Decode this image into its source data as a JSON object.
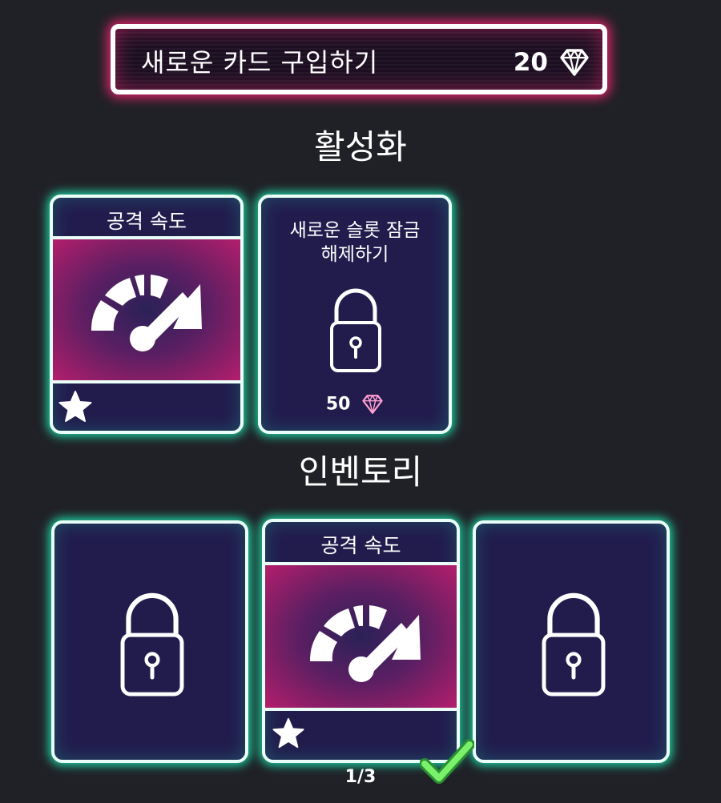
{
  "buy": {
    "label": "새로운 카드 구입하기",
    "price": "20",
    "icon": "gem-icon"
  },
  "active": {
    "title": "활성화",
    "card1": {
      "title": "공격 속도",
      "icon": "speedometer-icon",
      "badge": "star-icon"
    },
    "card2": {
      "line1": "새로운 슬롯 잠금",
      "line2": "해제하기",
      "icon": "lock-icon",
      "cost": "50",
      "cost_icon": "gem-icon"
    }
  },
  "inventory": {
    "title": "인벤토리",
    "card_center": {
      "title": "공격 속도",
      "icon": "speedometer-icon",
      "badge": "star-icon"
    },
    "locked_icon": "lock-icon",
    "page": "1/3",
    "selected_icon": "checkmark-icon"
  },
  "colors": {
    "background": "#202126",
    "card_bg": "#221c4d",
    "pink_glow": "#e0246b",
    "teal_glow": "#1fd8a8",
    "check": "#5ee04f"
  }
}
